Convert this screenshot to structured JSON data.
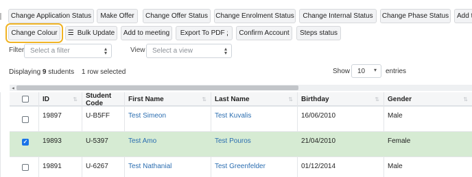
{
  "toolbar": {
    "row1": [
      {
        "label": "Change Application Status"
      },
      {
        "label": "Make Offer"
      },
      {
        "label": "Change Offer Status"
      },
      {
        "label": "Change Enrolment Status"
      },
      {
        "label": "Change Internal Status"
      },
      {
        "label": "Change Phase Status"
      },
      {
        "label": "Add t"
      }
    ],
    "change_colour": "Change Colour",
    "bulk_update": "Bulk Update",
    "add_meeting": "Add to meeting",
    "export_pdf": "Export To PDF",
    "confirm_account": "Confirm Account",
    "steps_status": "Steps status"
  },
  "filter": {
    "label": "Filter",
    "placeholder": "Select a filter"
  },
  "view": {
    "label": "View",
    "placeholder": "Select a view"
  },
  "summary": {
    "prefix": "Displaying",
    "count": "9",
    "suffix": "students",
    "selected": "1 row selected"
  },
  "pagination": {
    "show_label": "Show",
    "show_value": "10",
    "entries_label": "entries"
  },
  "table": {
    "columns": [
      "ID",
      "Student Code",
      "First Name",
      "Last Name",
      "Birthday",
      "Gender"
    ],
    "rows": [
      {
        "id": "19897",
        "code": "U-B5FF",
        "first": "Test Simeon",
        "last": "Test Kuvalis",
        "birthday": "16/06/2010",
        "gender": "Male",
        "checked": false
      },
      {
        "id": "19893",
        "code": "U-5397",
        "first": "Test Amo",
        "last": "Test Pouros",
        "birthday": "21/04/2010",
        "gender": "Female",
        "checked": true
      },
      {
        "id": "19891",
        "code": "U-6267",
        "first": "Test Nathanial",
        "last": "Test Greenfelder",
        "birthday": "01/12/2014",
        "gender": "Male",
        "checked": false
      }
    ]
  },
  "colors": {
    "highlight_outline": "#f0b323",
    "selected_row": "#d6ebd3",
    "link": "#2a6db0",
    "checkbox_checked": "#1a73e8"
  },
  "icons": {
    "bulk_update": "list-icon",
    "export_pdf": "info-icon",
    "sort": "sort-arrows-icon",
    "dropdown": "chevron-updown-icon"
  }
}
